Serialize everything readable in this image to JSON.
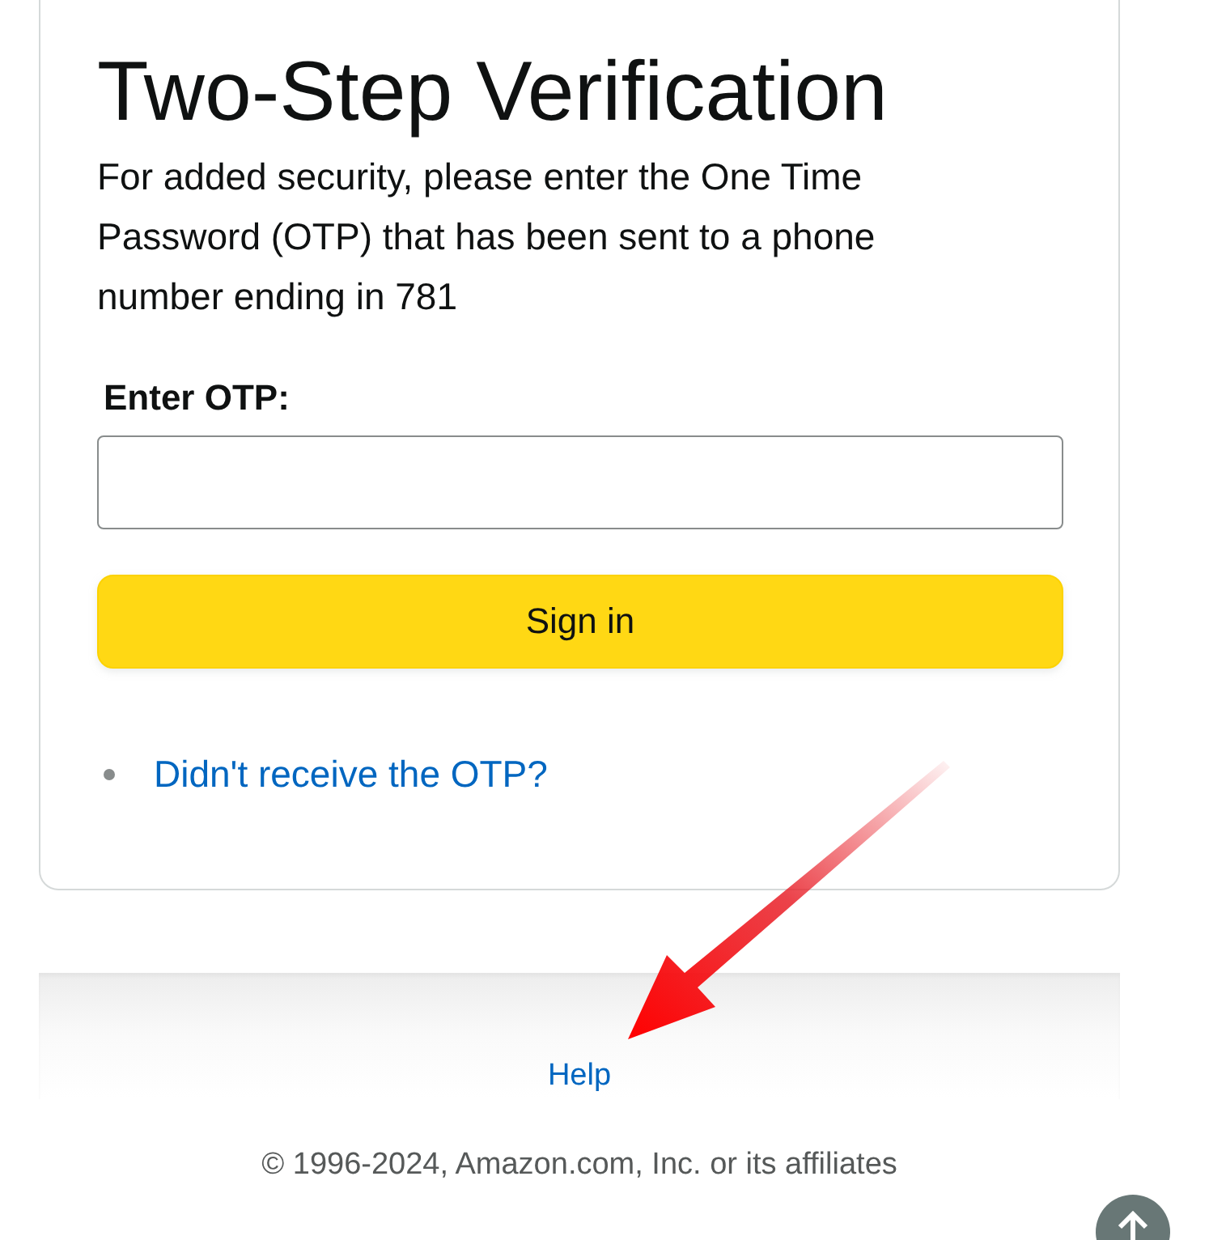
{
  "heading": "Two-Step Verification",
  "instructions": "For added security, please enter the One Time Password (OTP) that has been sent to a phone number ending in 781",
  "otp_field": {
    "label": "Enter OTP:"
  },
  "sign_in_button": "Sign in",
  "links": [
    {
      "text": "Didn't receive the OTP?"
    }
  ],
  "footer": {
    "help_link": "Help",
    "copyright": "© 1996-2024, Amazon.com, Inc. or its affiliates"
  }
}
